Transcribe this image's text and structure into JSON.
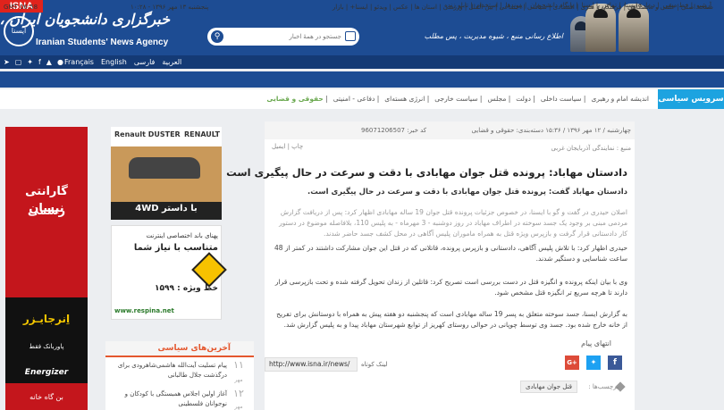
{
  "header": {
    "isna_tag": "ISNA",
    "logo_emblem": "ایسنا",
    "logo_fa": "خبرگزاری دانشجویان ایران ، ایسنا",
    "logo_en": "Iranian Students' News Agency",
    "search_placeholder": "جستجو در همهٔ اخبار",
    "slogan": "اطلاع رسانی منبع ، شیوه مدیریت ، پس مطلب"
  },
  "nav": {
    "items": [
      "آرشیو",
      "خط مشی",
      "درباره ایسنا",
      "تماس با ایسنا",
      "پایگاه دانشجویان",
      "پیوندها",
      "استخدام",
      "تابلو زنده"
    ],
    "languages": [
      "Français",
      "English",
      "العربية",
      "فارسی"
    ],
    "social_icons": [
      "telegram-icon",
      "instagram-icon",
      "twitter-icon",
      "facebook-icon",
      "android-icon",
      "apple-icon"
    ]
  },
  "subbar": {
    "time": "GMT 06:58",
    "date_fa": "پنجشنبه ۱۳ مهر ۱۳۹۶ - ۱۰:۲۸",
    "items": [
      "صفحه اصلی",
      "علمی و دانشگاهی",
      "فرهنگی و هنری",
      "اقتصادی",
      "سیاسی",
      "اجتماعی",
      "بین الملل",
      "ورزشی",
      "استان ها",
      "عکس",
      "ویدئو",
      "ایسنا+",
      "بازار"
    ]
  },
  "service": {
    "title": "سرویس سیاسی",
    "tabs": [
      "اندیشه امام و رهبری",
      "سیاست داخلی",
      "دولت",
      "مجلس",
      "سیاست خارجی",
      "انرژی هسته‌ای",
      "دفاعی - امنیتی",
      "حقوقی و قضایی"
    ]
  },
  "ads": {
    "left_l1": "گارانتی رسمی",
    "left_l2": "نیسان",
    "energizer_fa": "اِنرجایـزر",
    "energizer_cap": "پاوربانک فقط",
    "energizer_brand": "Energizer",
    "left_bottom": "بن گاه خانه",
    "renault_model": "Renault DUSTER",
    "renault_brand": "RENAULT",
    "renault_cap": "با داستر 4WD",
    "respina_l1": "پهنای باند اختصاصی اینترنت",
    "respina_l2": "متناسب با نیاز شما",
    "respina_phone": "خط ویژه : ۱۵۹۹",
    "respina_url": "www.respina.net"
  },
  "latest": {
    "title": "آخرین‌های سیاسی",
    "items": [
      {
        "num": "۱۱",
        "mon": "مهر",
        "text": "پیام تسلیت آیت‌الله هاشمی‌شاهرودی برای درگذشت جلال طالبانی"
      },
      {
        "num": "۱۲",
        "mon": "مهر",
        "text": "آغاز اولین اجلاس همبستگی با کودکان و نوجوانان فلسطینی"
      }
    ]
  },
  "article": {
    "date": "چهارشنبه / ۱۲ مهر ۱۳۹۶ / ۱۵:۳۶",
    "category": "دسته‌بندی: حقوقی و قضایی",
    "code_label": "کد خبر:",
    "code": "96071206507",
    "source": "منبع : نمایندگی آذربایجان غربی",
    "actions": "چاپ  |  ایمیل",
    "title": "دادستان مهاباد: پرونده قتل جوان مهابادی با دقت و سرعت در حال پیگیری است",
    "lead": "دادستان مهاباد گفت: پرونده قتل جوان مهابادی با دقت و سرعت در حال پیگیری است.",
    "p1": "اصلان حیدری در گفت و گو با ایسنا، در خصوص جزئیات پرونده قتل جوان 19 ساله مهابادی اظهار کرد: پس از دریافت گزارش مردمی مبنی بر وجود یک جسد سوخته در اطراف مهاباد در روز دوشنبه - 3 مهرماه - به پلیس 110، بلافاصله موضوع در دستور کار دادستانی قرار گرفت و بازپرس ویژه قتل به همراه ماموران پلیس آگاهی در محل کشف جسد حاضر شدند.",
    "p2": "حیدری اظهار کرد: با تلاش پلیس آگاهی، دادستانی و بازپرس پرونده، قاتلانی که در قتل این جوان مشارکت داشتند در کمتر از 48 ساعت شناسایی و دستگیر شدند.",
    "p3": "وی با بیان اینکه پرونده و انگیزه قتل در دست بررسی است تصریح کرد: قاتلین از زندان تحویل گرفته شده و تحت بازپرسی قرار دارند تا هرچه سریع تر انگیزه قتل مشخص شود.",
    "p4": "به گزارش ایسنا، جسد سوخته متعلق به پسر 19 ساله مهابادی است که پنجشنبه دو هفته پیش به همراه با دوستانش برای تفریح از خانه خارج شده بود. جسد وی توسط چوپانی در حوالی روستای کهریز از توابع شهرستان مهاباد پیدا و به پلیس گزارش شد.",
    "end_message": "انتهای پیام",
    "short_link_label": "لینک کوتاه",
    "short_link": "http://www.isna.ir/news/",
    "tags_label": "برچسب‌ها :",
    "tag": "قتل جوان مهابادی"
  },
  "colors": {
    "header_blue": "#1d4c93",
    "accent_cyan": "#1da3e0",
    "isna_red": "#e0231c",
    "latest_orange": "#e4572e"
  }
}
